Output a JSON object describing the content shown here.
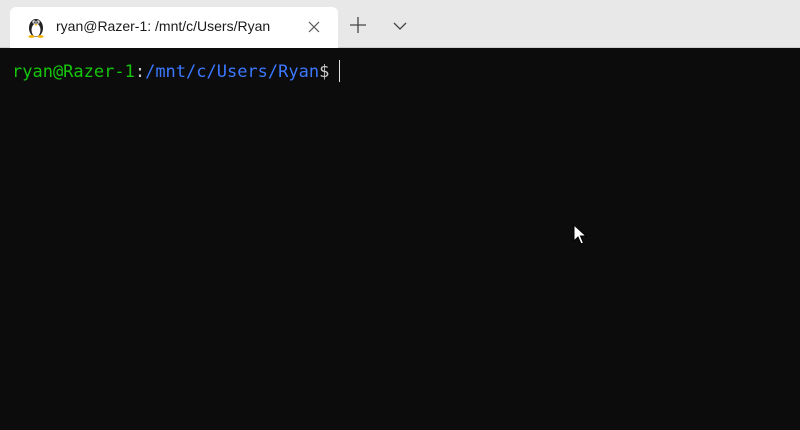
{
  "window": {
    "tab": {
      "icon": "linux-penguin-icon",
      "title": "ryan@Razer-1: /mnt/c/Users/Ryan",
      "close_icon": "close-icon"
    },
    "new_tab_icon": "plus-icon",
    "dropdown_icon": "chevron-down-icon"
  },
  "terminal": {
    "prompt": {
      "user_host": "ryan@Razer-1",
      "separator": ":",
      "path": "/mnt/c/Users/Ryan",
      "symbol": "$"
    }
  },
  "colors": {
    "background": "#0c0c0c",
    "titlebar": "#e8e8e8",
    "user_host": "#16c60c",
    "path": "#3b78ff",
    "text": "#cccccc"
  }
}
